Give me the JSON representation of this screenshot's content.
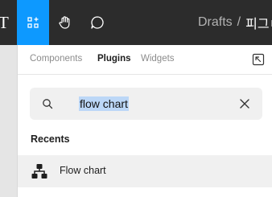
{
  "toolbar": {
    "text_tool": "T",
    "tools": [
      {
        "name": "resources",
        "icon": "resources-icon",
        "active": true
      },
      {
        "name": "hand",
        "icon": "hand-icon",
        "active": false
      },
      {
        "name": "comment",
        "icon": "comment-icon",
        "active": false
      }
    ]
  },
  "breadcrumb": {
    "drafts": "Drafts",
    "separator": "/",
    "file": "피그ㅁ"
  },
  "panel": {
    "tabs": [
      {
        "label": "Components",
        "active": false
      },
      {
        "label": "Plugins",
        "active": true
      },
      {
        "label": "Widgets",
        "active": false
      }
    ],
    "search": {
      "icon": "search-icon",
      "value": "flow chart",
      "clear_icon": "close-icon"
    },
    "recents_label": "Recents",
    "recents": [
      {
        "name": "Flow chart",
        "icon": "flow-chart-plugin-icon"
      }
    ]
  },
  "colors": {
    "accent": "#0d99ff",
    "toolbar_bg": "#2c2c2c",
    "selection": "#bcd7f7",
    "row_hover": "#f0f0f0"
  }
}
